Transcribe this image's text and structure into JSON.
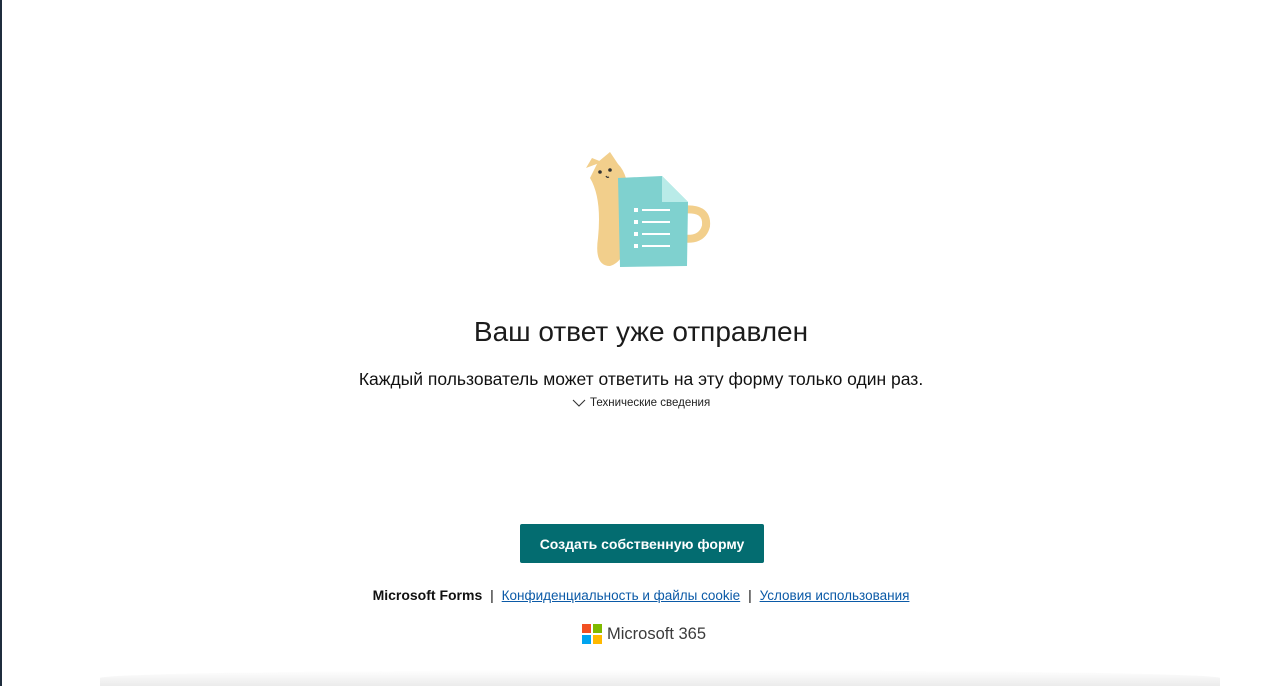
{
  "main": {
    "title": "Ваш ответ уже отправлен",
    "subtitle": "Каждый пользователь может ответить на эту форму только один раз.",
    "tech_details": "Технические сведения",
    "tech_icon": "chevron-down-icon",
    "illustration_icon": "cat-form-illustration"
  },
  "cta": {
    "create_label": "Создать собственную форму"
  },
  "footer": {
    "brand": "Microsoft Forms",
    "separator": "|",
    "privacy_link": "Конфиденциальность и файлы cookie",
    "terms_link": "Условия использования",
    "product": "Microsoft 365",
    "logo_colors": [
      "#f25022",
      "#7fba00",
      "#00a4ef",
      "#ffb900"
    ]
  },
  "colors": {
    "button": "#036c70",
    "link": "#0b5aa7"
  }
}
